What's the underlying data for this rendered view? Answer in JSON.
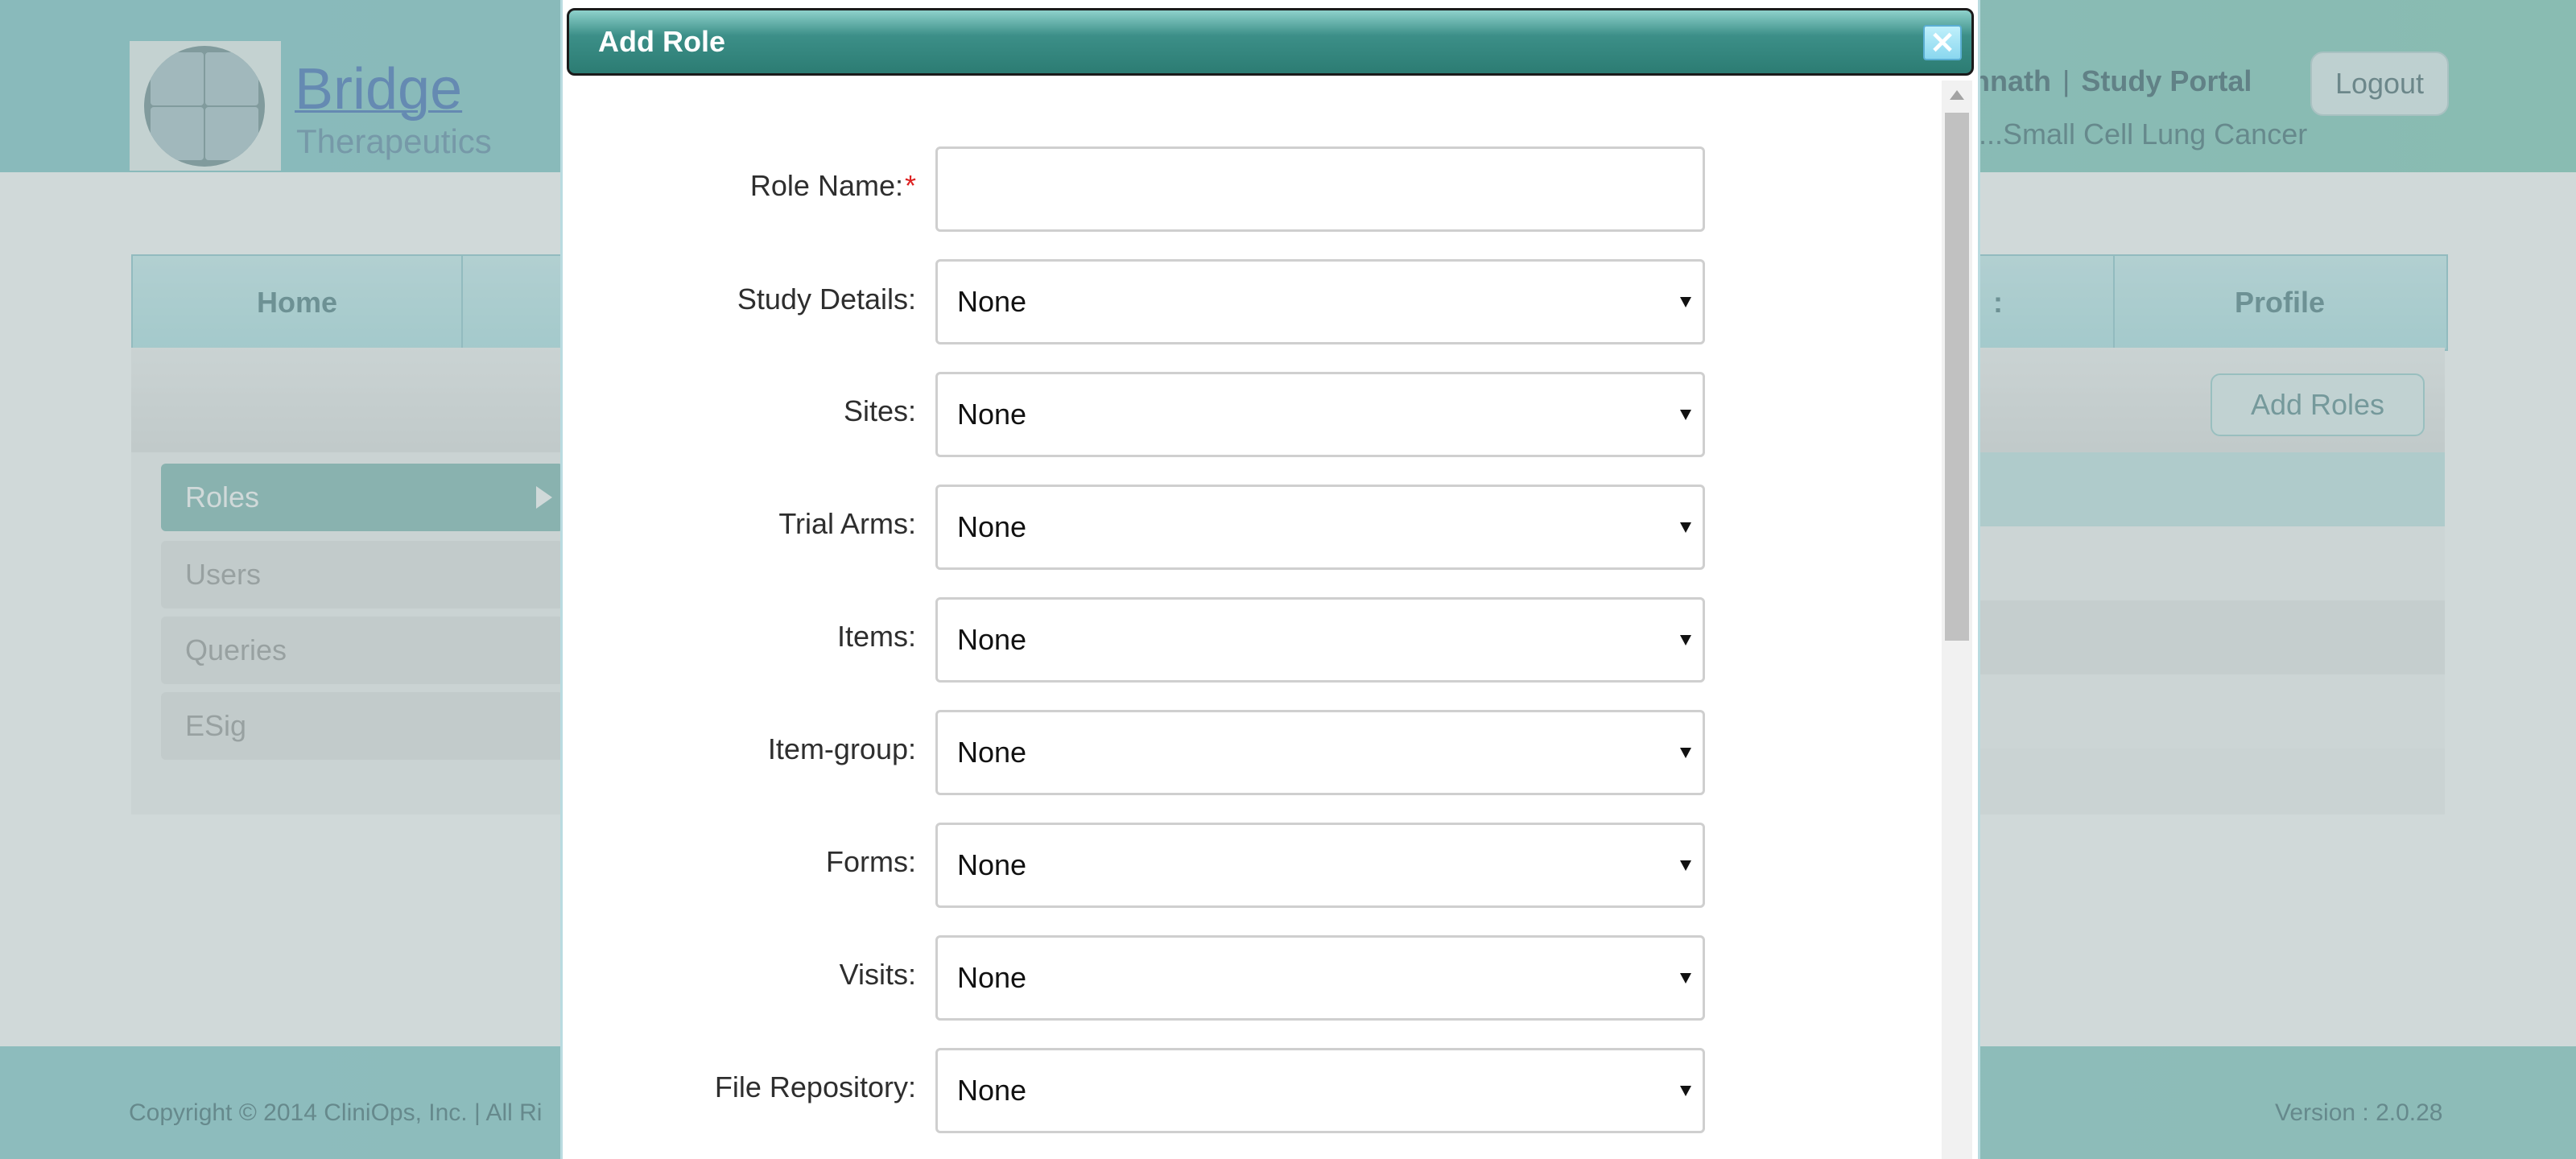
{
  "header": {
    "logo_title": "Bridge",
    "logo_subtitle": "Therapeutics",
    "user_name": "annath",
    "separator": "|",
    "portal_label": "Study Portal",
    "logout_label": "Logout",
    "study_name": "io...Small Cell Lung Cancer"
  },
  "nav": {
    "items": [
      {
        "label": "Home"
      },
      {
        "label": ":"
      },
      {
        "label": "Profile"
      }
    ]
  },
  "toolbar": {
    "add_roles_label": "Add Roles"
  },
  "sidebar": {
    "items": [
      {
        "label": "Roles",
        "active": true
      },
      {
        "label": "Users",
        "active": false
      },
      {
        "label": "Queries",
        "active": false
      },
      {
        "label": "ESig",
        "active": false
      }
    ]
  },
  "footer": {
    "copyright": "Copyright © 2014 CliniOps, Inc. | All Ri",
    "version": "Version : 2.0.28"
  },
  "modal": {
    "title": "Add Role",
    "close_icon": "close-icon",
    "role_name": {
      "label": "Role Name:",
      "required_mark": "*",
      "value": ""
    },
    "fields": [
      {
        "label": "Study Details:",
        "value": "None"
      },
      {
        "label": "Sites:",
        "value": "None"
      },
      {
        "label": "Trial Arms:",
        "value": "None"
      },
      {
        "label": "Items:",
        "value": "None"
      },
      {
        "label": "Item-group:",
        "value": "None"
      },
      {
        "label": "Forms:",
        "value": "None"
      },
      {
        "label": "Visits:",
        "value": "None"
      },
      {
        "label": "File Repository:",
        "value": "None"
      }
    ]
  },
  "colors": {
    "header_teal": "#7fc6c9",
    "titlebar_teal": "#2c7c73",
    "required_red": "#dd2222",
    "sidebar_active": "#7fb8b3"
  }
}
